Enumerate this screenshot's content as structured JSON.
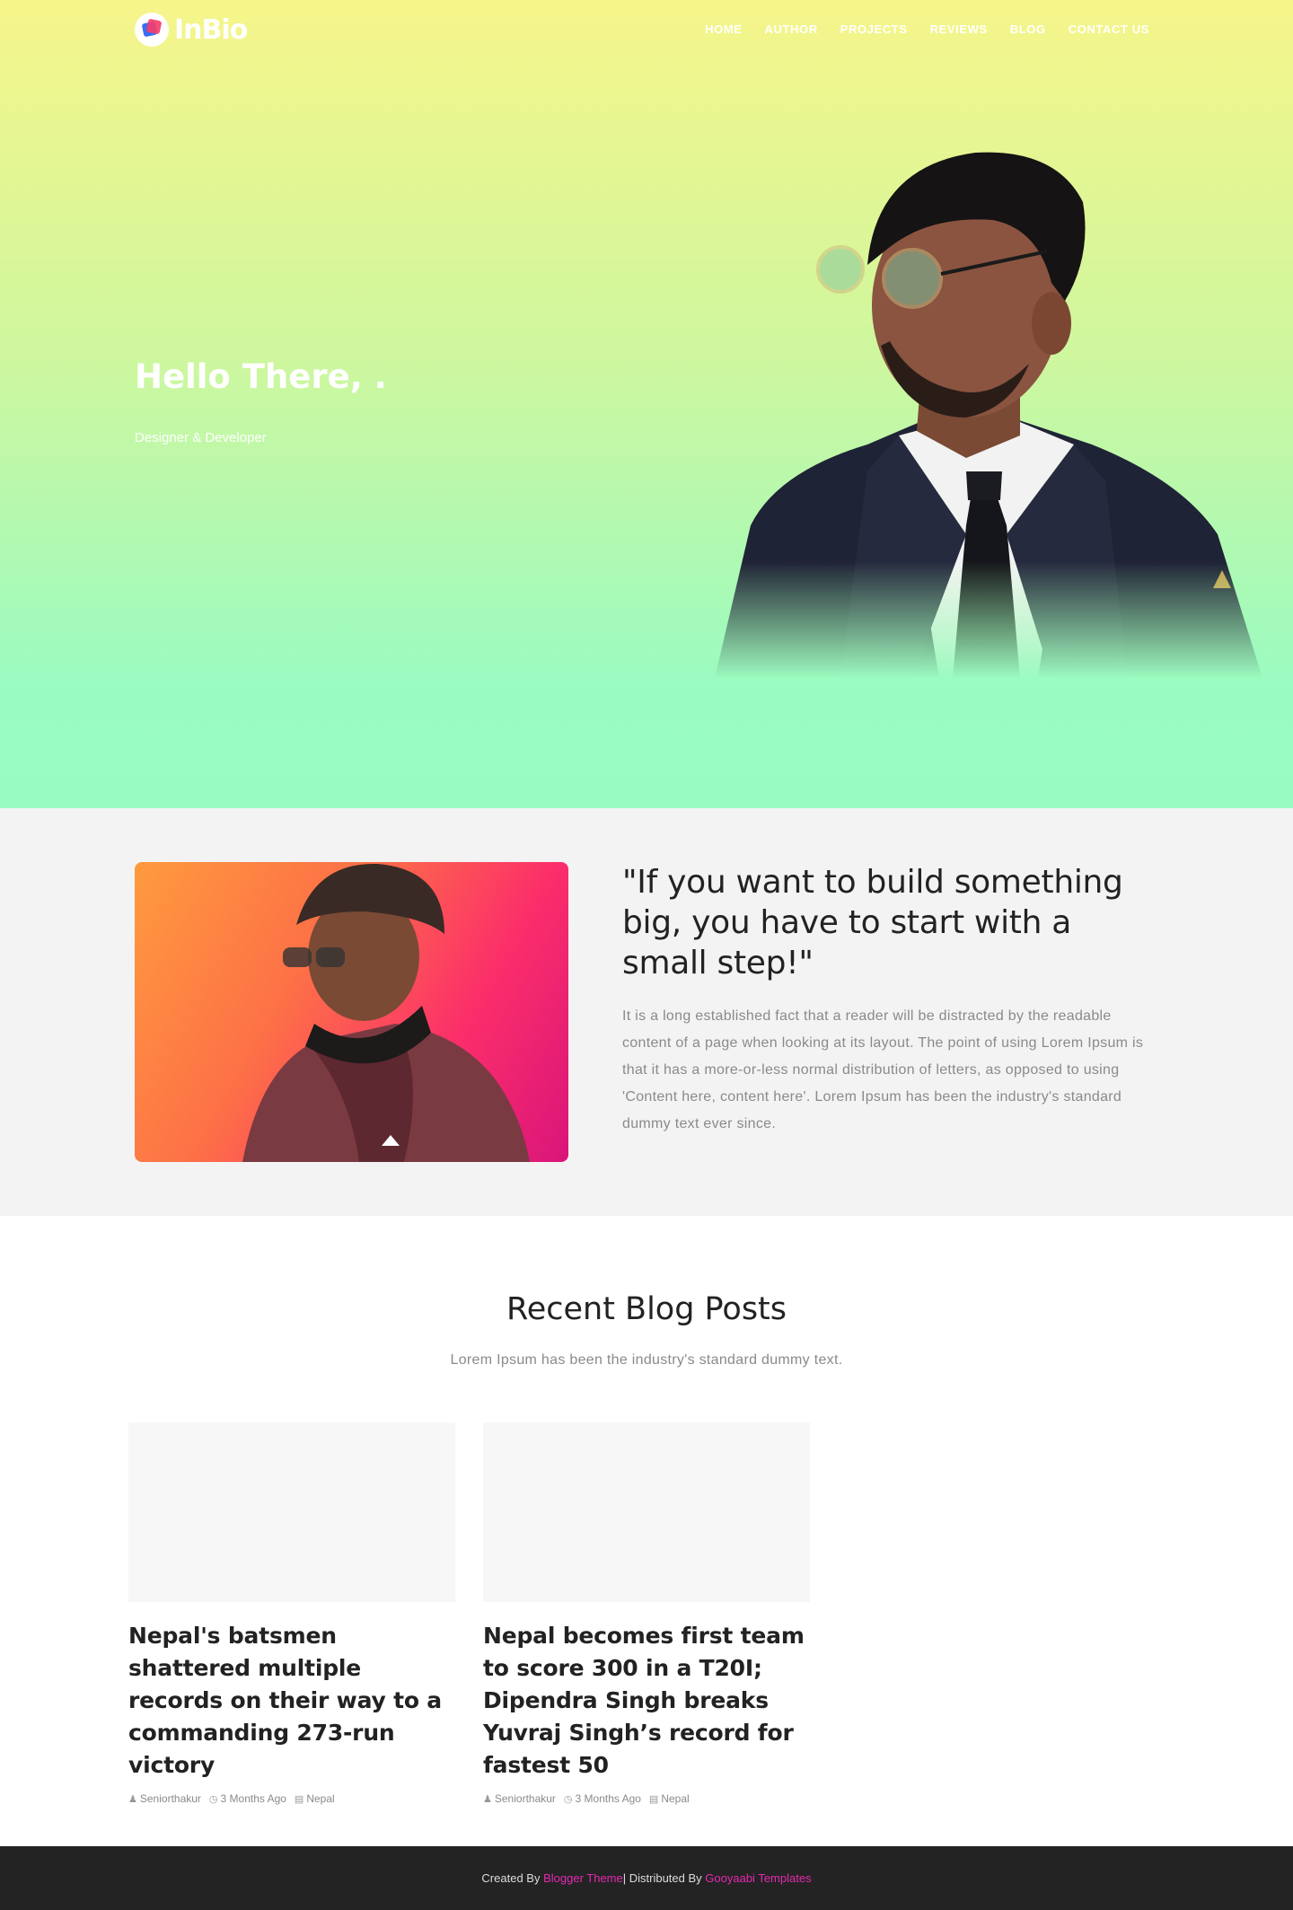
{
  "brand": {
    "logo_text": "InBio"
  },
  "nav": {
    "items": [
      "HOME",
      "AUTHOR",
      "PROJECTS",
      "REVIEWS",
      "BLOG",
      "CONTACT US"
    ]
  },
  "hero": {
    "title": "Hello There, .",
    "subtitle": "Designer & Developer"
  },
  "about": {
    "quote": "\"If you want to build something big, you have to start with a small step!\"",
    "body": "It is a long established fact that a reader will be distracted by the readable content of a page when looking at its layout. The point of using Lorem Ipsum is that it has a more-or-less normal distribution of letters, as opposed to using 'Content here, content here'. Lorem Ipsum has been the industry's standard dummy text ever since."
  },
  "blog": {
    "title": "Recent Blog Posts",
    "subtitle": "Lorem Ipsum has been the industry's standard dummy text.",
    "posts": [
      {
        "title": "Nepal's batsmen shattered multiple records on their way to a commanding 273-run victory",
        "author": "Seniorthakur",
        "date": "3 Months Ago",
        "category": "Nepal"
      },
      {
        "title": "Nepal becomes first team to score 300 in a T20I; Dipendra Singh breaks Yuvraj Singh’s record for fastest 50",
        "author": "Seniorthakur",
        "date": "3 Months Ago",
        "category": "Nepal"
      }
    ]
  },
  "footer": {
    "created_prefix": "Created By ",
    "created_link": "Blogger Theme",
    "distributed_prefix": " | Distributed By ",
    "distributed_link": "Gooyaabi Templates"
  },
  "colors": {
    "accent": "#e52ab0",
    "footer_bg": "#232323"
  },
  "icons": {
    "author": "user-icon",
    "date": "clock-icon",
    "category": "folder-icon"
  }
}
